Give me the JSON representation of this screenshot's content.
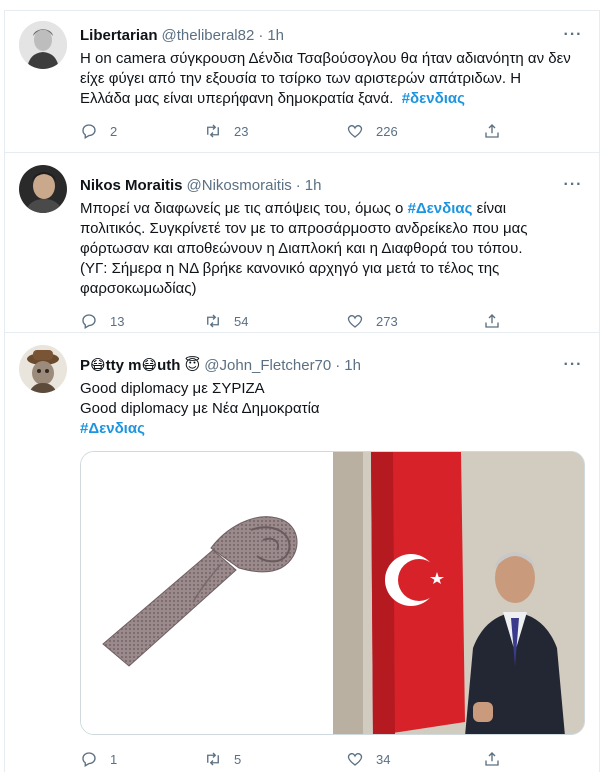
{
  "tweets": [
    {
      "name": "Libertarian",
      "handle": "@theliberal82",
      "dot": "·",
      "time": "1h",
      "lines": [
        "Η on camera σύγκρουση Δένδια Τσαβούσογλου θα ήταν αδιανόητη αν δεν",
        "είχε φύγει από την εξουσία το τσίρκο των αριστερών απάτριδων. Η",
        "Ελλάδα μας είναι υπερήφανη δημοκρατία ξανά."
      ],
      "hashtag": "#δενδιας",
      "replies": "2",
      "retweets": "23",
      "likes": "226"
    },
    {
      "name": "Nikos Moraitis",
      "handle": "@Nikosmoraitis",
      "dot": "·",
      "time": "1h",
      "line1_before": "Μπορεί να διαφωνείς με τις απόψεις του, όμως ο ",
      "hashtag": "#Δενδιας",
      "line1_after": " είναι",
      "lines": [
        "πολιτικός. Συγκρίνετέ τον με το απροσάρμοστο ανδρείκελο που μας",
        "φόρτωσαν και αποθεώνουν η Διαπλοκή και η Διαφθορά του τόπου.",
        "(ΥΓ: Σήμερα η ΝΔ βρήκε κανονικό αρχηγό για μετά το τέλος της",
        "φαρσοκωμωδίας)"
      ],
      "replies": "13",
      "retweets": "54",
      "likes": "273"
    },
    {
      "name_part1": "P",
      "name_emoji1": "😷",
      "name_part2": "tty m",
      "name_emoji2": "😷",
      "name_part3": "uth",
      "name_emoji3": "😇",
      "handle": "@John_Fletcher70",
      "dot": "·",
      "time": "1h",
      "lines": [
        "Good diplomacy με ΣΥΡΙΖΑ",
        "Good diplomacy με Νέα Δημοκρατία"
      ],
      "hashtag": "#Δενδιας",
      "replies": "1",
      "retweets": "5",
      "likes": "34"
    }
  ],
  "icons": {
    "more": "more-horizontal-icon",
    "reply": "reply-icon",
    "retweet": "retweet-icon",
    "like": "heart-icon",
    "share": "share-icon"
  },
  "colors": {
    "hashtag": "#1b95e0",
    "secondary": "#5b7083",
    "border": "#e6ecf0"
  }
}
